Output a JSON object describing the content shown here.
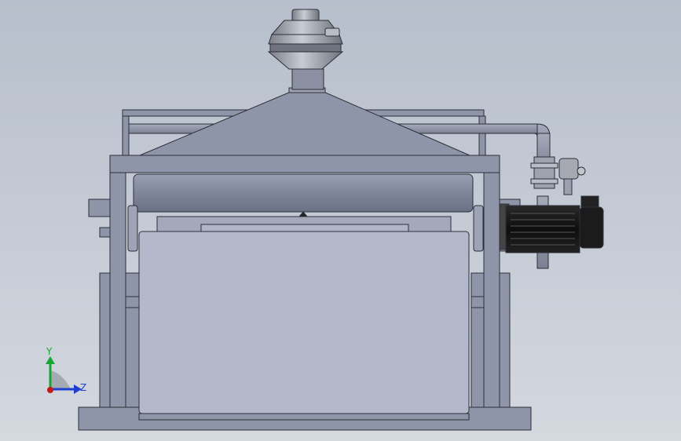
{
  "viewport": {
    "background_top": "#b7bfcc",
    "background_bottom": "#d4d8df",
    "model_fill": "#8f95a8",
    "model_stroke": "#2c2f38",
    "panel_fill": "#b3b9cb",
    "motor_fill": "#1b1b1b"
  },
  "triad": {
    "y_label": "Y",
    "z_label": "Z",
    "y_color": "#17a534",
    "z_color": "#1f3fd1",
    "x_color": "#c31818"
  }
}
